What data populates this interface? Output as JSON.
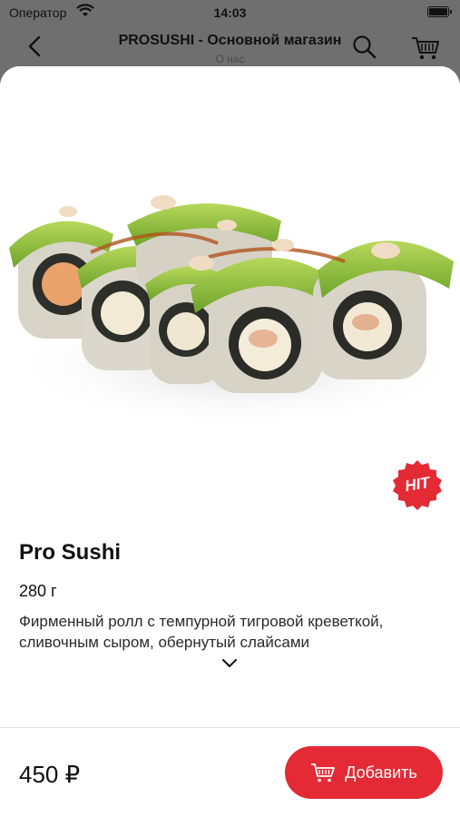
{
  "status_bar": {
    "carrier": "Оператор",
    "time": "14:03"
  },
  "nav": {
    "title": "PROSUSHI - Основной магазин",
    "subtitle": "О нас"
  },
  "product": {
    "badge": "HIT",
    "name": "Pro Sushi",
    "weight": "280 г",
    "description": "Фирменный ролл с темпурной тигровой креветкой, сливочным сыром, обернутый слайсами",
    "price": "450 ₽",
    "add_label": "Добавить"
  },
  "colors": {
    "accent": "#e32a35",
    "avocado": "#8fc43a"
  },
  "icons": [
    "back-chevron-icon",
    "search-icon",
    "cart-icon",
    "chevron-down-icon",
    "hit-badge-icon"
  ]
}
